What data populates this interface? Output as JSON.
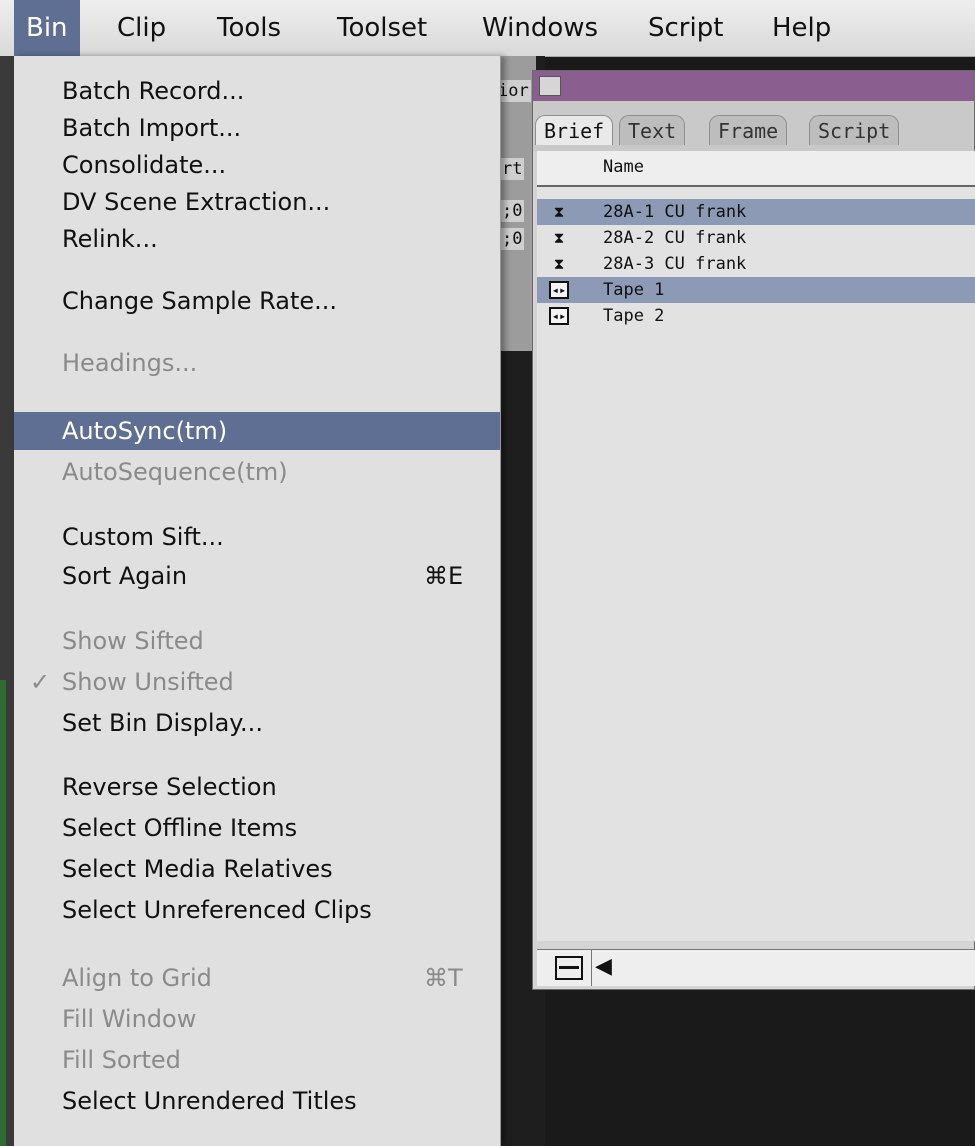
{
  "menubar": {
    "items": [
      "Bin",
      "Clip",
      "Tools",
      "Toolset",
      "Windows",
      "Script",
      "Help"
    ],
    "active": "Bin"
  },
  "background_fragments": [
    "ior",
    "rt",
    ";0",
    ";0"
  ],
  "bin_menu": {
    "items": [
      {
        "label": "Batch Record...",
        "shortcut": "",
        "enabled": true
      },
      {
        "label": "Batch Import...",
        "shortcut": "",
        "enabled": true
      },
      {
        "label": "Consolidate...",
        "shortcut": "",
        "enabled": true
      },
      {
        "label": "DV Scene Extraction...",
        "shortcut": "",
        "enabled": true
      },
      {
        "label": "Relink...",
        "shortcut": "",
        "enabled": true
      },
      {
        "label": "Change Sample Rate...",
        "shortcut": "",
        "enabled": true
      },
      {
        "label": "Headings...",
        "shortcut": "",
        "enabled": false
      },
      {
        "label": "AutoSync(tm)",
        "shortcut": "",
        "enabled": true,
        "highlighted": true
      },
      {
        "label": "AutoSequence(tm)",
        "shortcut": "",
        "enabled": false
      },
      {
        "label": "Custom Sift...",
        "shortcut": "",
        "enabled": true
      },
      {
        "label": "Sort Again",
        "shortcut": "⌘E",
        "enabled": true
      },
      {
        "label": "Show Sifted",
        "shortcut": "",
        "enabled": false
      },
      {
        "label": "Show Unsifted",
        "shortcut": "",
        "enabled": false,
        "checked": true
      },
      {
        "label": "Set Bin Display...",
        "shortcut": "",
        "enabled": true
      },
      {
        "label": "Reverse Selection",
        "shortcut": "",
        "enabled": true
      },
      {
        "label": "Select Offline Items",
        "shortcut": "",
        "enabled": true
      },
      {
        "label": "Select Media Relatives",
        "shortcut": "",
        "enabled": true
      },
      {
        "label": "Select Unreferenced Clips",
        "shortcut": "",
        "enabled": true
      },
      {
        "label": "Align to Grid",
        "shortcut": "⌘T",
        "enabled": false
      },
      {
        "label": "Fill Window",
        "shortcut": "",
        "enabled": false
      },
      {
        "label": "Fill Sorted",
        "shortcut": "",
        "enabled": false
      },
      {
        "label": "Select Unrendered Titles",
        "shortcut": "",
        "enabled": true
      }
    ],
    "check_glyph": "✓"
  },
  "bin_window": {
    "tabs": [
      "Brief",
      "Text",
      "Frame",
      "Script"
    ],
    "selected_tab": "Brief",
    "column_header": "Name",
    "rows": [
      {
        "name": "28A-1 CU frank",
        "icon": "subclip-icon",
        "selected": true
      },
      {
        "name": "28A-2 CU frank",
        "icon": "subclip-icon",
        "selected": false
      },
      {
        "name": "28A-3 CU frank",
        "icon": "subclip-icon",
        "selected": false
      },
      {
        "name": "Tape 1",
        "icon": "tape-icon",
        "selected": true
      },
      {
        "name": "Tape 2",
        "icon": "tape-icon",
        "selected": false
      }
    ],
    "bottom_icons": [
      "bin-menu-icon",
      "arrow-left-icon"
    ]
  },
  "colors": {
    "highlight": "#5f6f93",
    "row_selection": "#8c9ab6",
    "bin_titlebar": "#8a5f8f"
  }
}
